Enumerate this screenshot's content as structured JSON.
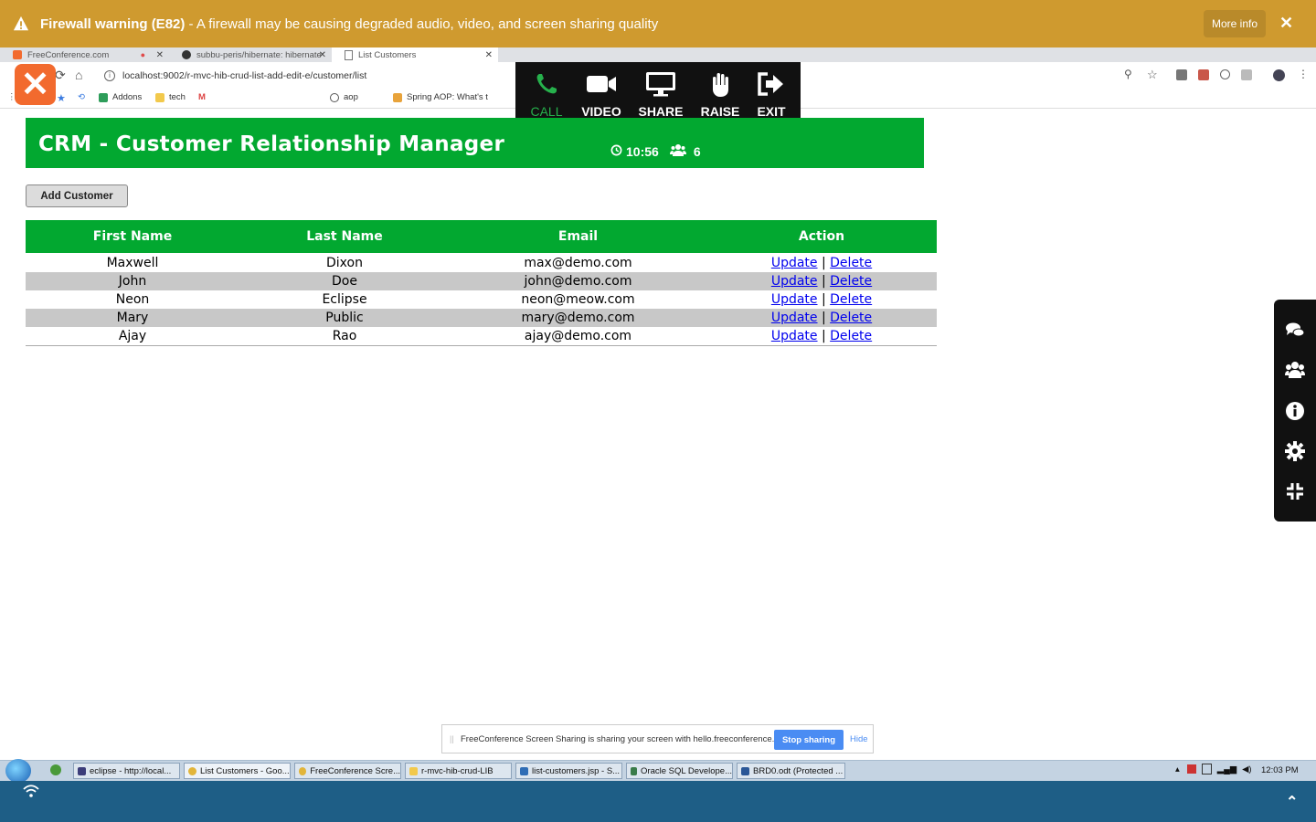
{
  "banner": {
    "title": "Firewall warning (E82)",
    "message": " - A firewall may be causing degraded audio, video, and screen sharing quality",
    "more_info": "More info",
    "close": "✕"
  },
  "browser": {
    "tabs": [
      {
        "label": "FreeConference.com",
        "close": "✕"
      },
      {
        "label": "subbu-peris/hibernate: hibernate",
        "close": "✕"
      },
      {
        "label": "List Customers",
        "close": "✕"
      }
    ],
    "new_tab": "+",
    "url": "localhost:9002/r-mvc-hib-crud-list-add-edit-e/customer/list",
    "bookmarks": [
      {
        "label": "Addons"
      },
      {
        "label": "tech"
      },
      {
        "label": "aop"
      },
      {
        "label": "Spring AOP: What's t"
      }
    ]
  },
  "call_toolbar": {
    "call": "CALL",
    "video": "VIDEO",
    "share": "SHARE",
    "raise": "RAISE",
    "exit": "EXIT",
    "timer": "10:56",
    "participants": "6"
  },
  "page": {
    "title": "CRM - Customer Relationship Manager",
    "add_button": "Add Customer",
    "columns": [
      "First Name",
      "Last Name",
      "Email",
      "Action"
    ],
    "rows": [
      {
        "first": "Maxwell",
        "last": "Dixon",
        "email": "max@demo.com",
        "update": "Update",
        "sep": "|",
        "delete": "Delete"
      },
      {
        "first": "John",
        "last": "Doe",
        "email": "john@demo.com",
        "update": "Update",
        "sep": "|",
        "delete": "Delete"
      },
      {
        "first": "Neon",
        "last": "Eclipse",
        "email": "neon@meow.com",
        "update": "Update",
        "sep": "|",
        "delete": "Delete"
      },
      {
        "first": "Mary",
        "last": "Public",
        "email": "mary@demo.com",
        "update": "Update",
        "sep": "|",
        "delete": "Delete"
      },
      {
        "first": "Ajay",
        "last": "Rao",
        "email": "ajay@demo.com",
        "update": "Update",
        "sep": "|",
        "delete": "Delete"
      }
    ]
  },
  "share_notice": {
    "text": "FreeConference Screen Sharing is sharing your screen with hello.freeconference.com.",
    "stop": "Stop sharing",
    "hide": "Hide"
  },
  "taskbar": {
    "items": [
      {
        "label": "eclipse - http://local..."
      },
      {
        "label": "List Customers - Goo..."
      },
      {
        "label": "FreeConference Scre..."
      },
      {
        "label": "r-mvc-hib-crud-LIB"
      },
      {
        "label": "list-customers.jsp - S..."
      },
      {
        "label": "Oracle SQL Develope..."
      },
      {
        "label": "BRD0.odt (Protected ..."
      }
    ],
    "clock": "12:03 PM"
  },
  "colors": {
    "banner": "#cf9a2f",
    "header_green": "#02a830",
    "alt_row": "#c8c8c8",
    "link": "#0000ee",
    "call_green": "#26b14c",
    "logo_orange": "#f26a2e"
  }
}
